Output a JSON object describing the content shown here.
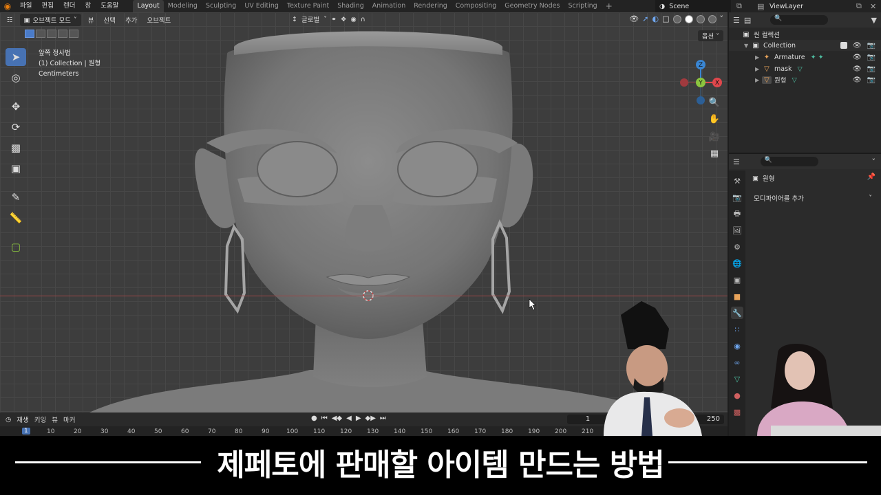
{
  "menubar": {
    "menus": [
      "파일",
      "편집",
      "렌더",
      "창",
      "도움말"
    ],
    "workspaces": [
      "Layout",
      "Modeling",
      "Sculpting",
      "UV Editing",
      "Texture Paint",
      "Shading",
      "Animation",
      "Rendering",
      "Compositing",
      "Geometry Nodes",
      "Scripting"
    ],
    "active_workspace": "Layout",
    "add_tab": "+",
    "scene": "Scene",
    "view_layer": "ViewLayer"
  },
  "viewport_header": {
    "mode": "오브젝트 모드",
    "menus": [
      "뷰",
      "선택",
      "추가",
      "오브젝트"
    ],
    "transform_orientation": "글로벌",
    "options": "옵션"
  },
  "viewport_info": {
    "view_name": "앞쪽 정사법",
    "collection_line": "(1) Collection | 원형",
    "units": "Centimeters"
  },
  "gizmo": {
    "x": "X",
    "y": "Y",
    "z": "Z"
  },
  "timeline": {
    "menus": [
      "재생",
      "키잉",
      "뷰",
      "마커"
    ],
    "current_frame": "1",
    "end_frame": "250",
    "ticks": [
      "1",
      "10",
      "20",
      "30",
      "40",
      "50",
      "60",
      "70",
      "80",
      "90",
      "100",
      "110",
      "120",
      "130",
      "140",
      "150",
      "160",
      "170",
      "180",
      "190",
      "200",
      "210"
    ]
  },
  "outliner": {
    "scene_collection": "씬 컬렉션",
    "rows": [
      {
        "label": "Collection"
      },
      {
        "label": "Armature"
      },
      {
        "label": "mask"
      },
      {
        "label": "원형"
      }
    ]
  },
  "properties": {
    "object_name": "원형",
    "add_modifier": "모디파이어를 추가"
  },
  "subtitle": "제페토에 판매할 아이템 만드는 방법",
  "colors": {
    "accent": "#4772b3",
    "axis_x": "#e0474c",
    "axis_y": "#8bc53f",
    "axis_z": "#3a86d3"
  }
}
